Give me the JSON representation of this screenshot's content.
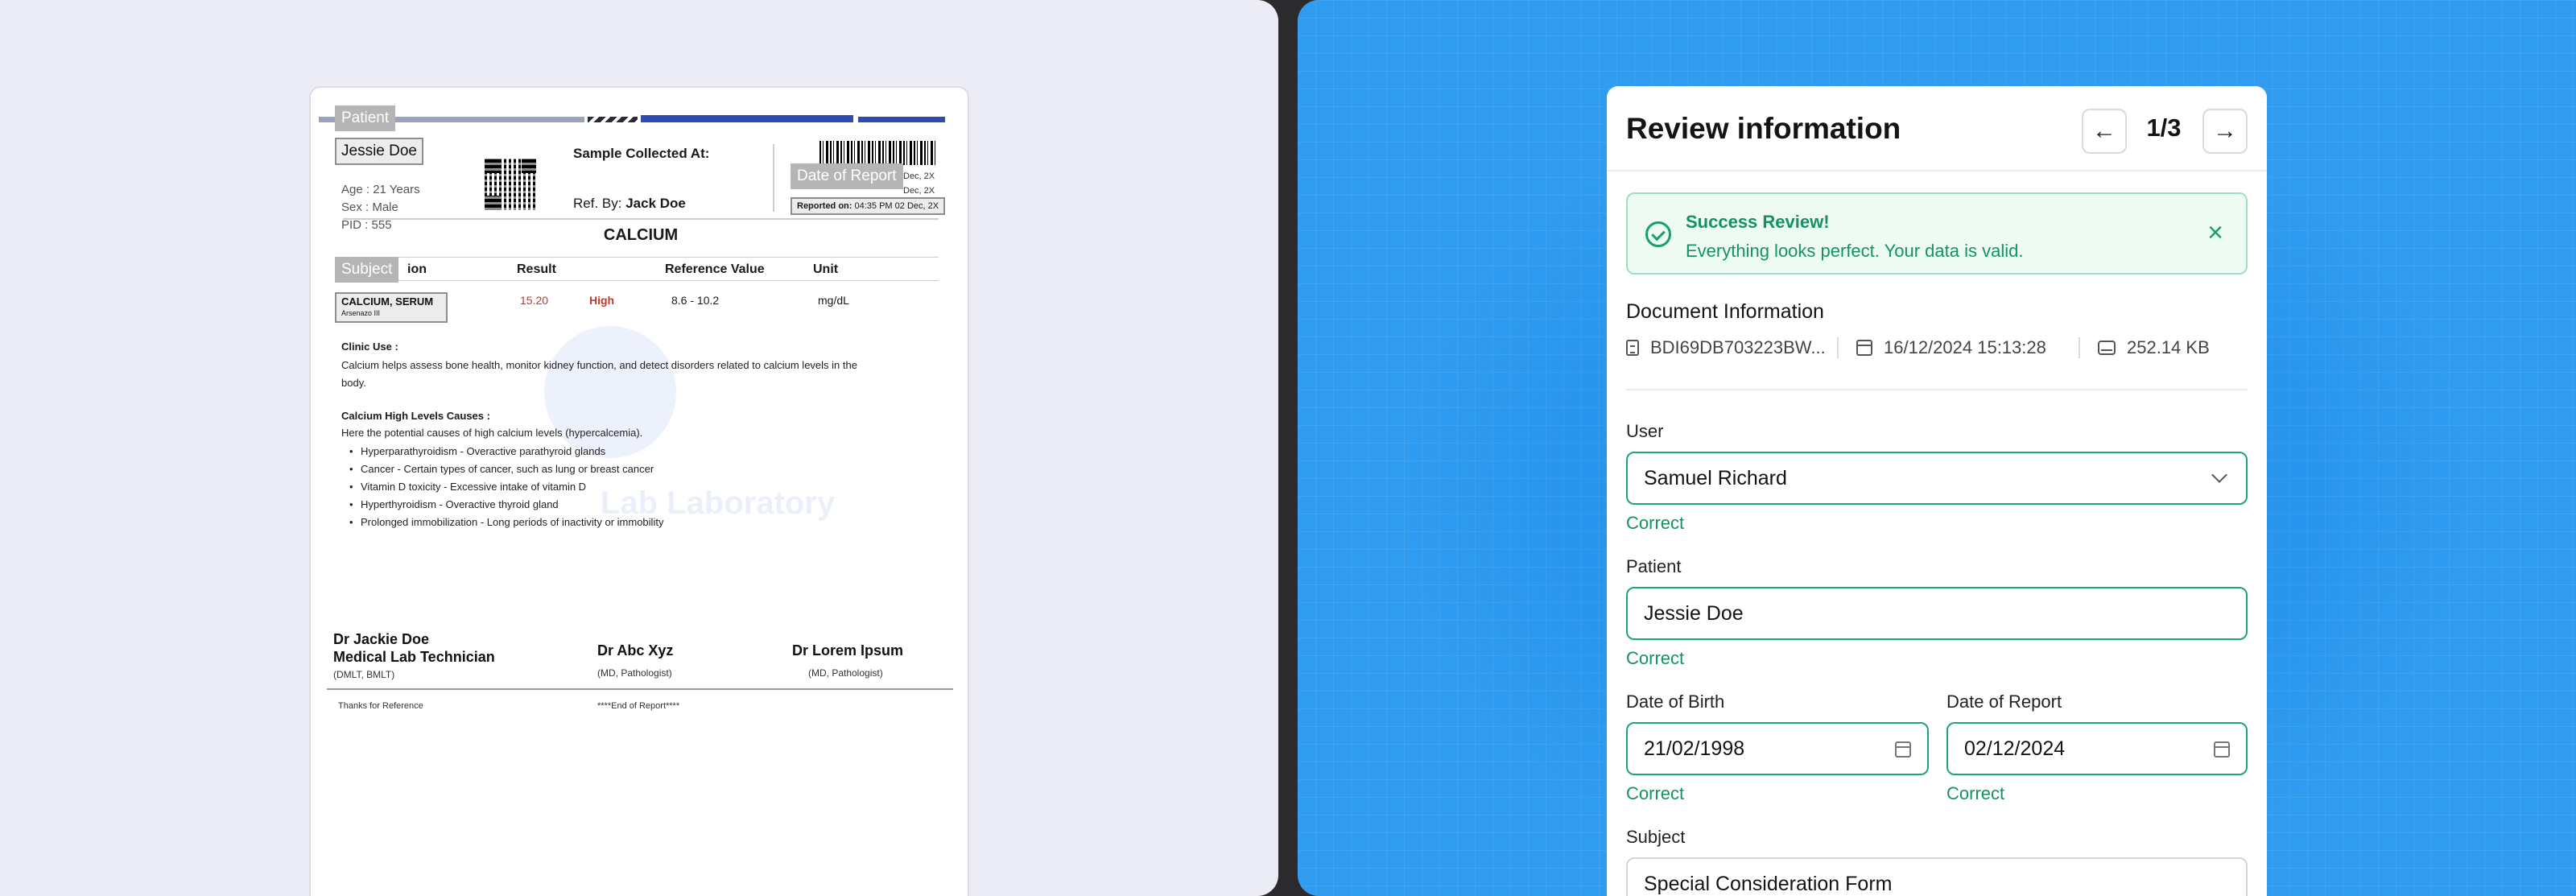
{
  "document": {
    "annotations": {
      "patient_label": "Patient",
      "patient_value": "Jessie Doe",
      "date_of_report_label": "Date of Report",
      "subject_label": "Subject",
      "subject_value": "CALCIUM, SERUM",
      "subject_sub": "Arsenazo III"
    },
    "patient_info": {
      "age": "Age : 21 Years",
      "sex": "Sex : Male",
      "pid": "PID : 555"
    },
    "sample_collected": "Sample Collected At:",
    "ref_by_label": "Ref. By:",
    "ref_by_value": "Jack Doe",
    "dec1": "Dec, 2X",
    "dec2": "Dec, 2X",
    "reported_label": "Reported on:",
    "reported_value": "04:35 PM 02 Dec, 2X",
    "test_title": "CALCIUM",
    "table_headers": {
      "investigation": "ion",
      "result": "Result",
      "reference": "Reference Value",
      "unit": "Unit"
    },
    "result": {
      "value": "15.20",
      "flag": "High",
      "reference": "8.6 - 10.2",
      "unit": "mg/dL"
    },
    "clinic_use_title": "Clinic Use :",
    "clinic_use_line1": "Calcium helps assess bone health, monitor kidney function, and detect disorders related to calcium levels in the",
    "clinic_use_line2": "body.",
    "causes_title": "Calcium High Levels Causes :",
    "causes_intro": "Here the potential causes of high calcium levels (hypercalcemia).",
    "causes": [
      "Hyperparathyroidism - Overactive parathyroid glands",
      "Cancer - Certain types of cancer, such as lung or breast cancer",
      "Vitamin D toxicity - Excessive intake of vitamin D",
      "Hyperthyroidism - Overactive thyroid gland",
      "Prolonged immobilization - Long periods of inactivity or immobility"
    ],
    "watermark_text": "Lab Laboratory",
    "signatures": {
      "s1_name": "Dr Jackie Doe",
      "s1_title": "Medical Lab Technician",
      "s1_sub": "(DMLT, BMLT)",
      "s2_name": "Dr Abc Xyz",
      "s2_sub": "(MD, Pathologist)",
      "s3_name": "Dr Lorem Ipsum",
      "s3_sub": "(MD, Pathologist)"
    },
    "footer_left": "Thanks for Reference",
    "footer_center": "****End of Report****"
  },
  "review": {
    "title": "Review information",
    "page_indicator": "1/3",
    "alert_title": "Success Review!",
    "alert_message": "Everything looks perfect. Your data is valid.",
    "doc_info_title": "Document Information",
    "doc_id": "BDI69DB703223BW...",
    "doc_datetime": "16/12/2024 15:13:28",
    "doc_size": "252.14 KB",
    "user_label": "User",
    "user_value": "Samuel Richard",
    "user_status": "Correct",
    "patient_label": "Patient",
    "patient_value": "Jessie Doe",
    "patient_status": "Correct",
    "dob_label": "Date of Birth",
    "dob_value": "21/02/1998",
    "dob_status": "Correct",
    "dor_label": "Date of Report",
    "dor_value": "02/12/2024",
    "dor_status": "Correct",
    "subject_label": "Subject",
    "subject_value": "Special Consideration Form"
  },
  "colors": {
    "success": "#15935f",
    "accent_blue": "#2f9cf0",
    "doc_blue": "#2f4bb0",
    "result_red": "#c0392b"
  }
}
